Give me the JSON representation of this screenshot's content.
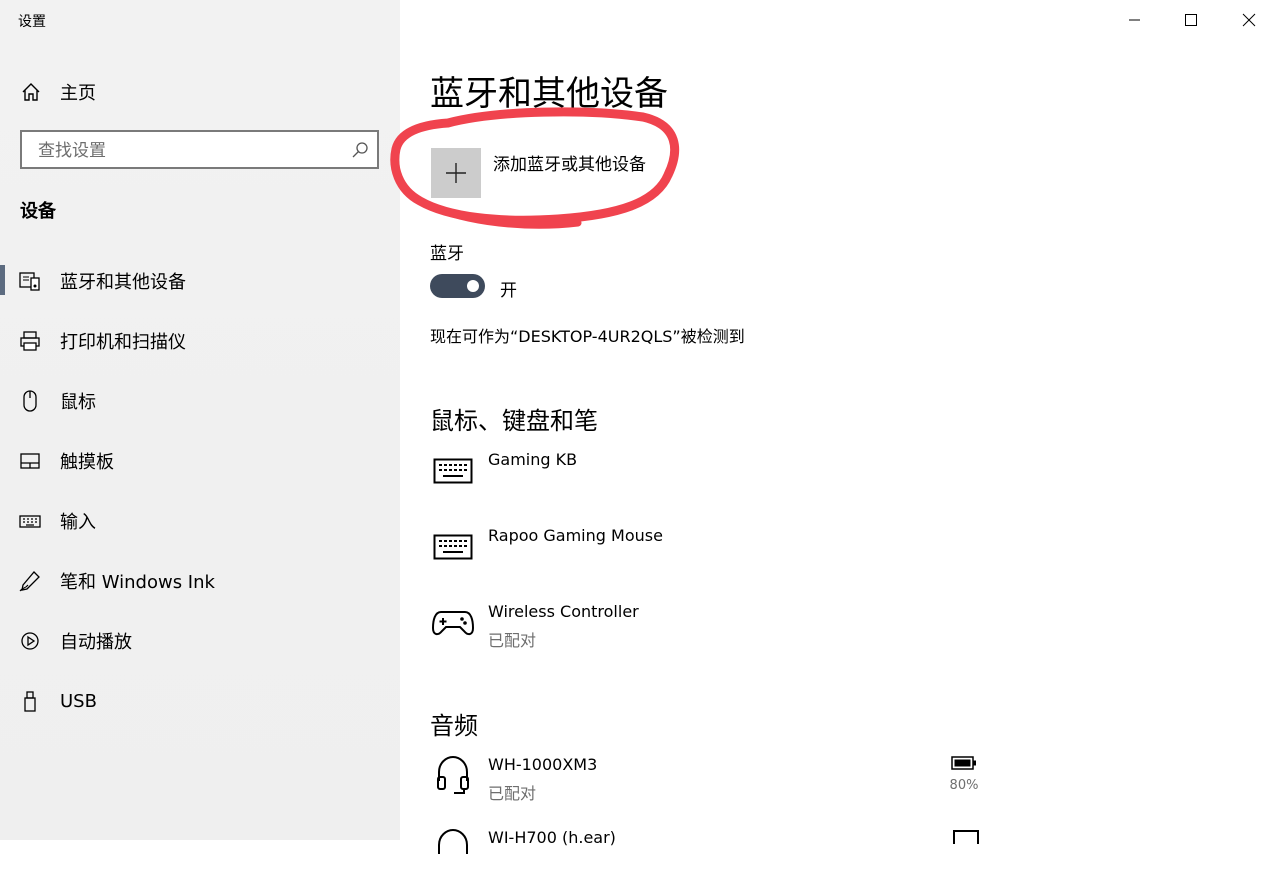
{
  "window": {
    "title": "设置"
  },
  "sidebar": {
    "home_label": "主页",
    "search_placeholder": "查找设置",
    "section_title": "设备",
    "items": [
      {
        "label": "蓝牙和其他设备",
        "icon": "bluetooth-devices-icon",
        "selected": true
      },
      {
        "label": "打印机和扫描仪",
        "icon": "printer-icon"
      },
      {
        "label": "鼠标",
        "icon": "mouse-icon"
      },
      {
        "label": "触摸板",
        "icon": "touchpad-icon"
      },
      {
        "label": "输入",
        "icon": "keyboard-icon"
      },
      {
        "label": "笔和 Windows Ink",
        "icon": "pen-icon"
      },
      {
        "label": "自动播放",
        "icon": "autoplay-icon"
      },
      {
        "label": "USB",
        "icon": "usb-icon"
      }
    ]
  },
  "main": {
    "title": "蓝牙和其他设备",
    "add_device_label": "添加蓝牙或其他设备",
    "bluetooth": {
      "label": "蓝牙",
      "toggle_state": "开",
      "discoverable_text": "现在可作为“DESKTOP-4UR2QLS”被检测到"
    },
    "groups": [
      {
        "title": "鼠标、键盘和笔",
        "devices": [
          {
            "name": "Gaming KB",
            "status": "",
            "icon": "keyboard-icon"
          },
          {
            "name": "Rapoo Gaming Mouse",
            "status": "",
            "icon": "keyboard-icon"
          },
          {
            "name": "Wireless Controller",
            "status": "已配对",
            "icon": "gamepad-icon"
          }
        ]
      },
      {
        "title": "音频",
        "devices": [
          {
            "name": "WH-1000XM3",
            "status": "已配对",
            "icon": "headphones-icon",
            "battery": "80%"
          },
          {
            "name": "WI-H700 (h.ear)",
            "status": "",
            "icon": "headphones-icon"
          }
        ]
      }
    ]
  },
  "colors": {
    "sidebar_bg": "#f2f2f2",
    "accent": "#3e4a5c",
    "annotation": "#f0434e"
  }
}
